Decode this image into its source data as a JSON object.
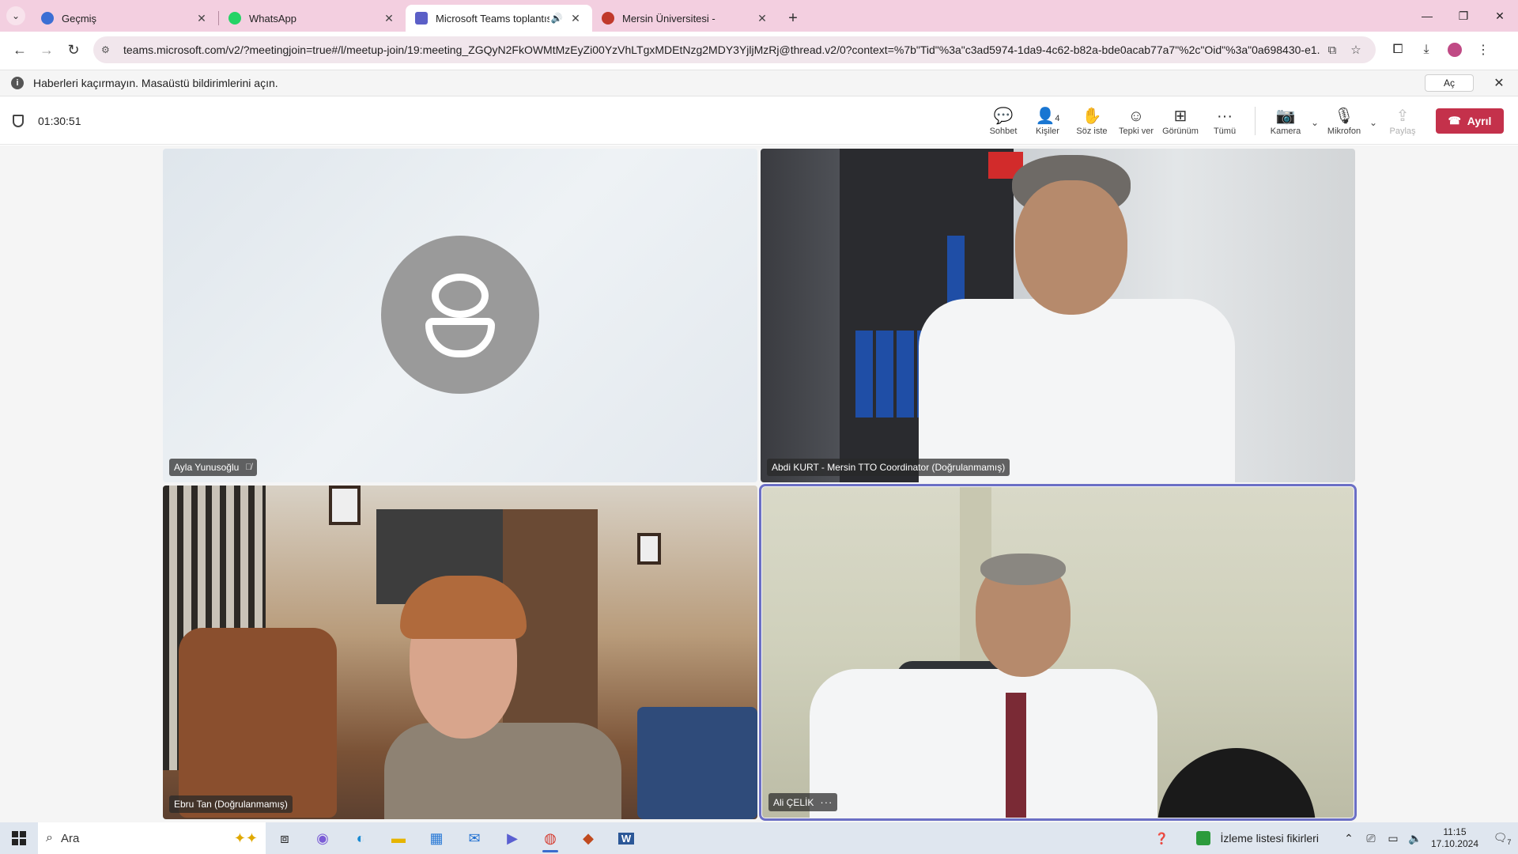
{
  "browser": {
    "tabs": [
      {
        "label": "Geçmiş",
        "icon": "history-icon",
        "favicon_color": "#3b6fd4"
      },
      {
        "label": "WhatsApp",
        "icon": "whatsapp-icon",
        "favicon_color": "#25d366"
      },
      {
        "label": "Microsoft Teams toplantısı",
        "icon": "teams-icon",
        "favicon_color": "#5b5fc7",
        "active": true,
        "audio": true
      },
      {
        "label": "Mersin Üniversitesi -",
        "icon": "university-icon",
        "favicon_color": "#c0392b"
      }
    ],
    "url": "teams.microsoft.com/v2/?meetingjoin=true#/l/meetup-join/19:meeting_ZGQyN2FkOWMtMzEyZi00YzVhLTgxMDEtNzg2MDY3YjljMzRj@thread.v2/0?context=%7b\"Tid\"%3a\"c3ad5974-1da9-4c62-b82a-bde0acab77a7\"%2c\"Oid\"%3a\"0a698430-e1..."
  },
  "infobar": {
    "text": "Haberleri kaçırmayın. Masaüstü bildirimlerini açın.",
    "open_label": "Aç"
  },
  "meeting": {
    "timer": "01:30:51",
    "controls": {
      "chat": "Sohbet",
      "people": "Kişiler",
      "people_count": "4",
      "raise_hand": "Söz iste",
      "react": "Tepki ver",
      "view": "Görünüm",
      "more": "Tümü",
      "camera": "Kamera",
      "mic": "Mikrofon",
      "share": "Paylaş",
      "leave": "Ayrıl"
    },
    "participants": [
      {
        "name": "Ayla Yunusoğlu",
        "mic_muted": true
      },
      {
        "name": "Abdi KURT - Mersin TTO Coordinator (Doğrulanmamış)"
      },
      {
        "name": "Ebru Tan (Doğrulanmamış)"
      },
      {
        "name": "Ali ÇELİK",
        "speaking": true
      }
    ]
  },
  "taskbar": {
    "search_placeholder": "Ara",
    "news": "İzleme listesi fikirleri",
    "time": "11:15",
    "date": "17.10.2024",
    "notification_count": "7"
  }
}
